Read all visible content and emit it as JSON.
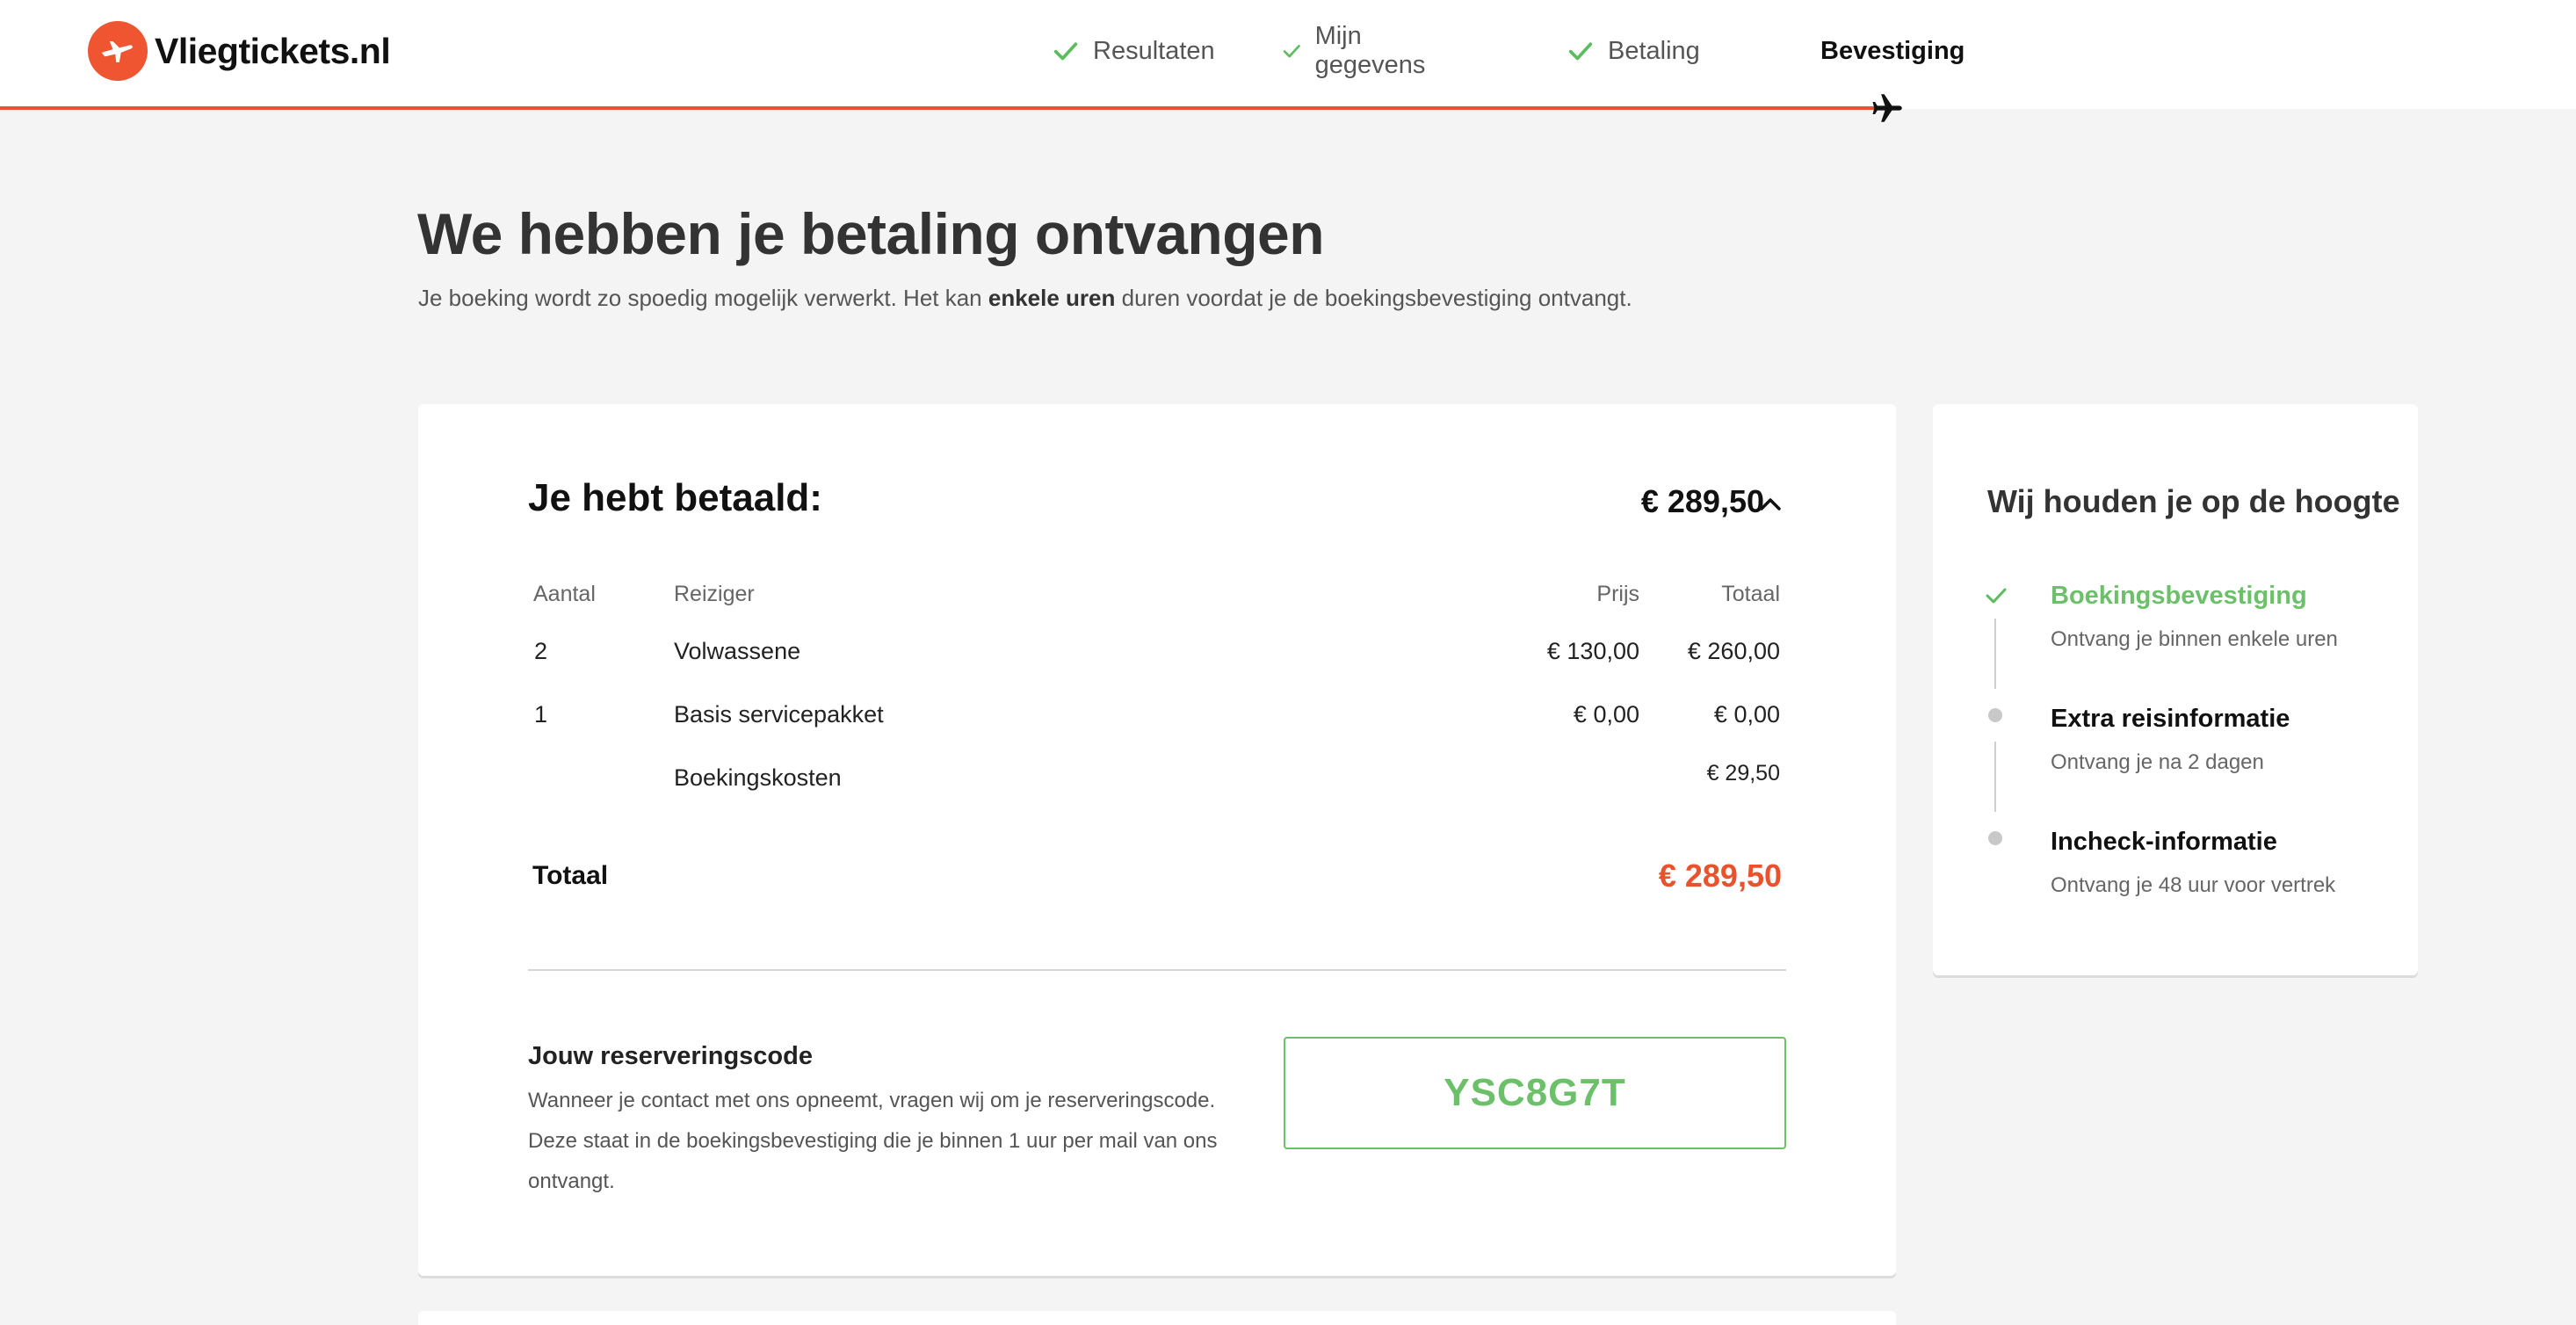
{
  "header": {
    "brand": "Vliegtickets.nl",
    "accent_color": "#e9522c",
    "steps": [
      {
        "label": "Resultaten",
        "done": true
      },
      {
        "label": "Mijn gegevens",
        "done": true
      },
      {
        "label": "Betaling",
        "done": true
      },
      {
        "label": "Bevestiging",
        "done": false,
        "active": true
      }
    ]
  },
  "page": {
    "title": "We hebben je betaling ontvangen",
    "subtitle_pre": "Je boeking wordt zo spoedig mogelijk verwerkt. Het kan ",
    "subtitle_bold": "enkele uren",
    "subtitle_post": " duren voordat je de boekingsbevestiging ontvangt."
  },
  "payment": {
    "title": "Je hebt betaald:",
    "amount": "€ 289,50",
    "columns": {
      "qty": "Aantal",
      "traveler": "Reiziger",
      "price": "Prijs",
      "total": "Totaal"
    },
    "rows": [
      {
        "qty": "2",
        "traveler": "Volwassene",
        "price": "€ 130,00",
        "total": "€ 260,00"
      },
      {
        "qty": "1",
        "traveler": "Basis servicepakket",
        "price": "€ 0,00",
        "total": "€ 0,00"
      },
      {
        "qty": "",
        "traveler": "Boekingskosten",
        "price": "",
        "total": "€ 29,50"
      }
    ],
    "total_label": "Totaal",
    "total_amount": "€ 289,50"
  },
  "reservation": {
    "title": "Jouw reserveringscode",
    "description": "Wanneer je contact met ons opneemt, vragen wij om je reserveringscode. Deze staat in de boekingsbevestiging die je binnen 1 uur per mail van ons ontvangt.",
    "code": "YSC8G7T",
    "code_color": "#6cc06a"
  },
  "updates": {
    "title": "Wij houden je op de hoogte",
    "items": [
      {
        "title": "Boekingsbevestiging",
        "sub": "Ontvang je binnen enkele uren",
        "done": true
      },
      {
        "title": "Extra reisinformatie",
        "sub": "Ontvang je na 2 dagen",
        "done": false
      },
      {
        "title": "Incheck-informatie",
        "sub": "Ontvang je 48 uur voor vertrek",
        "done": false
      }
    ]
  }
}
